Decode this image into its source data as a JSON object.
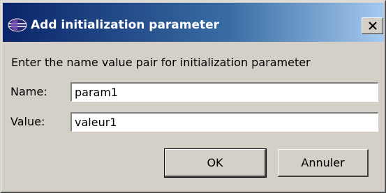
{
  "dialog": {
    "title": "Add initialization parameter",
    "prompt": "Enter the name value pair for initialization parameter",
    "name_label": "Name:",
    "name_value": "param1",
    "value_label": "Value:",
    "value_value": "valeur1",
    "ok_label": "OK",
    "cancel_label": "Annuler"
  },
  "icons": {
    "title_icon": "eclipse-app-icon",
    "close_icon": "close-icon"
  },
  "colors": {
    "titlebar_start": "#0a246a",
    "titlebar_end": "#a6caf0",
    "window_face": "#d4d0c8"
  }
}
